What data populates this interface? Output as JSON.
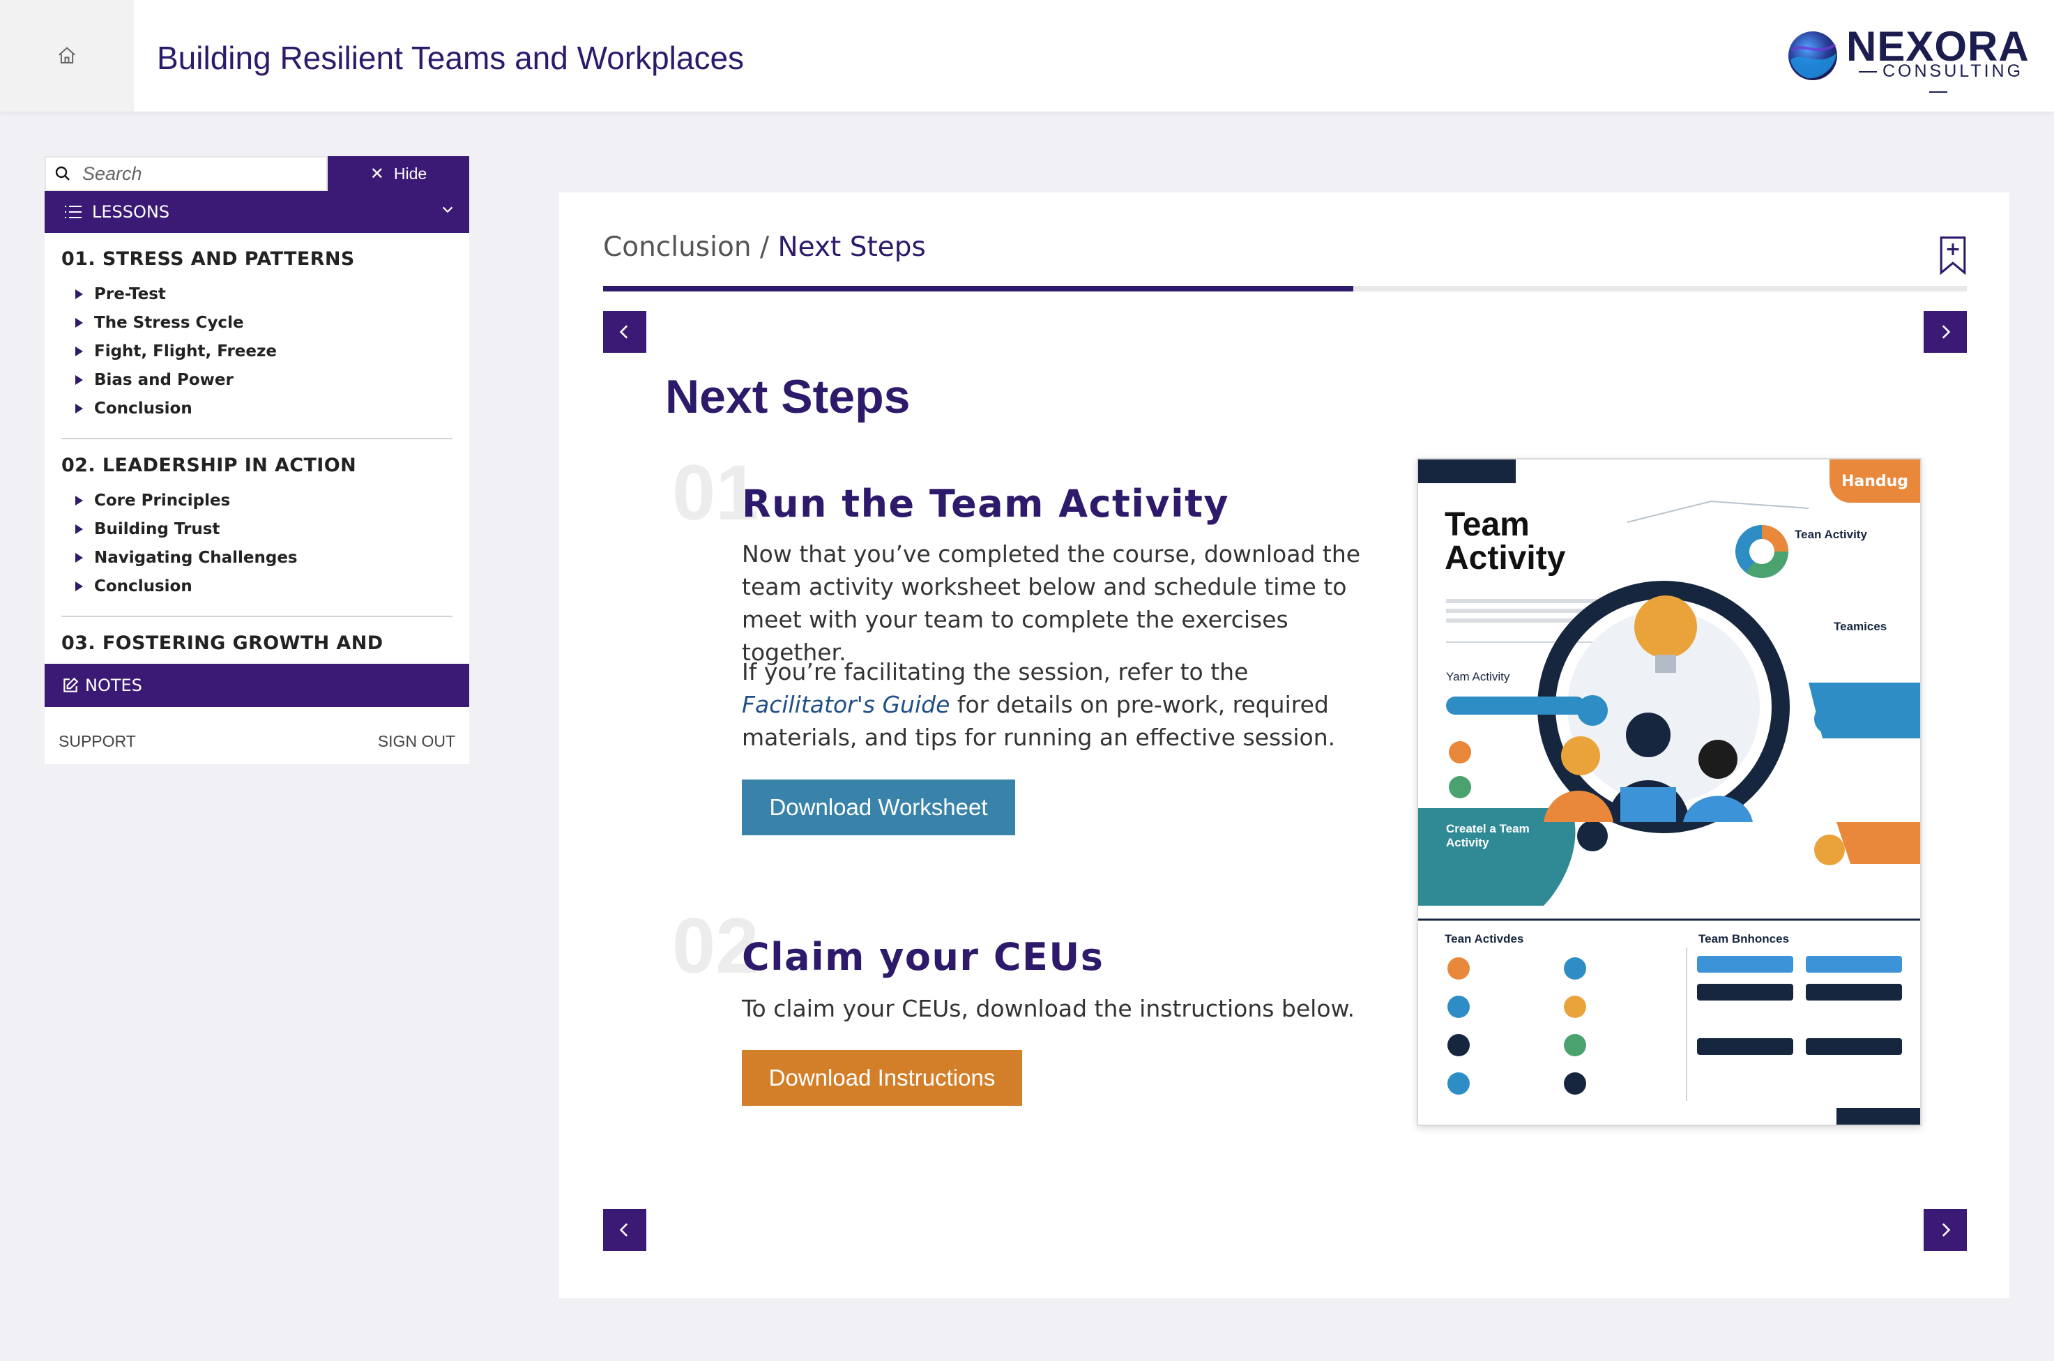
{
  "header": {
    "course_title": "Building Resilient Teams and Workplaces",
    "logo_brand": "NEXORA",
    "logo_sub": "CONSULTING"
  },
  "sidebar": {
    "search_placeholder": "Search",
    "hide_label": "Hide",
    "lessons_label": "LESSONS",
    "modules": [
      {
        "title": "01. STRESS AND PATTERNS",
        "items": [
          "Pre-Test",
          "The Stress Cycle",
          "Fight, Flight, Freeze",
          "Bias and Power",
          "Conclusion"
        ]
      },
      {
        "title": "02. LEADERSHIP IN ACTION",
        "items": [
          "Core Principles",
          "Building Trust",
          "Navigating Challenges",
          "Conclusion"
        ]
      },
      {
        "title": "03. FOSTERING GROWTH AND",
        "items": []
      }
    ],
    "notes_label": "NOTES",
    "support_label": "SUPPORT",
    "signout_label": "SIGN OUT"
  },
  "content": {
    "breadcrumb_parent": "Conclusion",
    "breadcrumb_sep": " / ",
    "breadcrumb_current": "Next Steps",
    "progress": 0.55,
    "heading": "Next Steps",
    "steps": [
      {
        "num": "01",
        "title": "Run the Team Activity",
        "para1": "Now that you’ve completed the course, download the team activity worksheet below and schedule time to meet with your team to complete the exercises together.",
        "para2_pre": "If you’re facilitating the session, refer to the ",
        "para2_link": "Facilitator's Guide",
        "para2_post": " for details on pre-work, required materials, and tips for running an effective session.",
        "button": "Download Worksheet"
      },
      {
        "num": "02",
        "title": "Claim your CEUs",
        "para1": "To claim your CEUs, download the instructions below.",
        "button": "Download Instructions"
      }
    ],
    "worksheet": {
      "title_line1": "Team",
      "title_line2": "Activity",
      "tag": "Handug",
      "label_team_activity": "Tean Activity",
      "label_teamices": "Teamices",
      "label_yam_activity": "Yam Activity",
      "label_create": "Createl a Team Activity",
      "label_activities": "Tean Activdes",
      "label_bnhonces": "Team Bnhonces"
    }
  },
  "colors": {
    "primary": "#3b1a75",
    "heading": "#2e1a6b",
    "blue_button": "#3983ab",
    "orange_button": "#d37f2a"
  }
}
